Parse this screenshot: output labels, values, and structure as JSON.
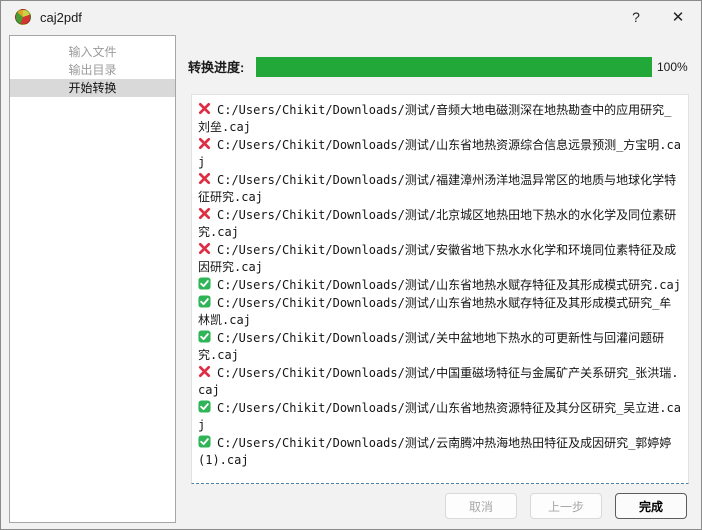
{
  "window": {
    "title": "caj2pdf",
    "help_label": "?",
    "close_label": "✕"
  },
  "sidebar": {
    "items": [
      {
        "label": "输入文件",
        "state": "disabled"
      },
      {
        "label": "输出目录",
        "state": "disabled"
      },
      {
        "label": "开始转换",
        "state": "active"
      }
    ]
  },
  "progress": {
    "label": "转换进度:",
    "percent": 100,
    "percent_text": "100%"
  },
  "file_list": {
    "items": [
      {
        "status": "error",
        "path": "C:/Users/Chikit/Downloads/测试/音频大地电磁测深在地热勘查中的应用研究_刘垒.caj"
      },
      {
        "status": "error",
        "path": "C:/Users/Chikit/Downloads/测试/山东省地热资源综合信息远景预测_方宝明.caj"
      },
      {
        "status": "error",
        "path": "C:/Users/Chikit/Downloads/测试/福建漳州汤洋地温异常区的地质与地球化学特征研究.caj"
      },
      {
        "status": "error",
        "path": "C:/Users/Chikit/Downloads/测试/北京城区地热田地下热水的水化学及同位素研究.caj"
      },
      {
        "status": "error",
        "path": "C:/Users/Chikit/Downloads/测试/安徽省地下热水水化学和环境同位素特征及成因研究.caj"
      },
      {
        "status": "success",
        "path": "C:/Users/Chikit/Downloads/测试/山东省地热水赋存特征及其形成模式研究.caj"
      },
      {
        "status": "success",
        "path": "C:/Users/Chikit/Downloads/测试/山东省地热水赋存特征及其形成模式研究_牟林凯.caj"
      },
      {
        "status": "success",
        "path": "C:/Users/Chikit/Downloads/测试/关中盆地地下热水的可更新性与回灌问题研究.caj"
      },
      {
        "status": "error",
        "path": "C:/Users/Chikit/Downloads/测试/中国重磁场特征与金属矿产关系研究_张洪瑞.caj"
      },
      {
        "status": "success",
        "path": "C:/Users/Chikit/Downloads/测试/山东省地热资源特征及其分区研究_吴立进.caj"
      },
      {
        "status": "success",
        "path": "C:/Users/Chikit/Downloads/测试/云南腾冲热海地热田特征及成因研究_郭婷婷(1).caj"
      }
    ]
  },
  "footer": {
    "buttons": [
      {
        "label": "取消",
        "state": "disabled"
      },
      {
        "label": "上一步",
        "state": "disabled"
      },
      {
        "label": "完成",
        "state": "default"
      }
    ]
  },
  "colors": {
    "progress_green": "#22a838",
    "error_red": "#dd2e44",
    "success_green": "#2fb457",
    "sidebar_highlight": "#d9d9d9"
  }
}
